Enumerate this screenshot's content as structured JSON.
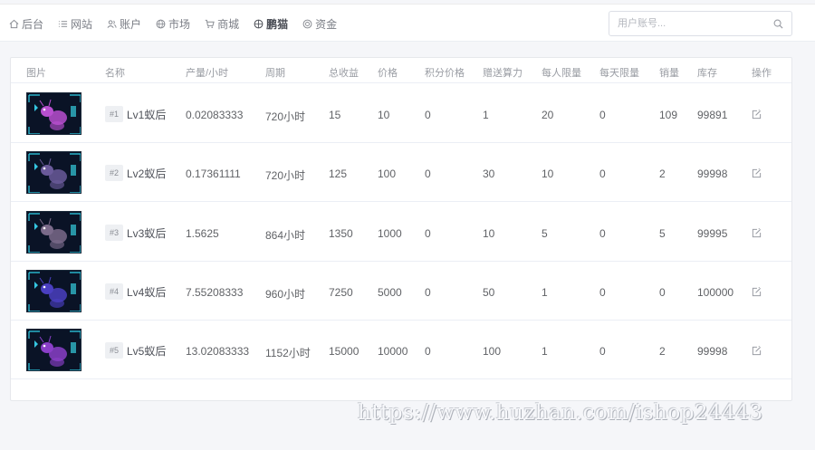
{
  "nav": {
    "items": [
      {
        "label": "后台",
        "icon": "home-icon",
        "active": false
      },
      {
        "label": "网站",
        "icon": "list-icon",
        "active": false
      },
      {
        "label": "账户",
        "icon": "users-icon",
        "active": false
      },
      {
        "label": "市场",
        "icon": "globe-icon",
        "active": false
      },
      {
        "label": "商城",
        "icon": "cart-icon",
        "active": false
      },
      {
        "label": "鹏猫",
        "icon": "grid-icon",
        "active": true
      },
      {
        "label": "资金",
        "icon": "coin-icon",
        "active": false
      }
    ]
  },
  "search": {
    "placeholder": "用户账号...",
    "icon": "search-icon"
  },
  "table": {
    "headers": [
      "图片",
      "名称",
      "产量/小时",
      "周期",
      "总收益",
      "价格",
      "积分价格",
      "赠送算力",
      "每人限量",
      "每天限量",
      "销量",
      "库存",
      "操作"
    ],
    "rows": [
      {
        "index": "#1",
        "name": "Lv1蚁后",
        "output": "0.02083333",
        "cycle": "720小时",
        "total": "15",
        "price": "10",
        "points_price": "0",
        "bonus_power": "1",
        "per_person": "20",
        "per_day": "0",
        "sales": "109",
        "stock": "99891"
      },
      {
        "index": "#2",
        "name": "Lv2蚁后",
        "output": "0.17361111",
        "cycle": "720小时",
        "total": "125",
        "price": "100",
        "points_price": "0",
        "bonus_power": "30",
        "per_person": "10",
        "per_day": "0",
        "sales": "2",
        "stock": "99998"
      },
      {
        "index": "#3",
        "name": "Lv3蚁后",
        "output": "1.5625",
        "cycle": "864小时",
        "total": "1350",
        "price": "1000",
        "points_price": "0",
        "bonus_power": "10",
        "per_person": "5",
        "per_day": "0",
        "sales": "5",
        "stock": "99995"
      },
      {
        "index": "#4",
        "name": "Lv4蚁后",
        "output": "7.55208333",
        "cycle": "960小时",
        "total": "7250",
        "price": "5000",
        "points_price": "0",
        "bonus_power": "50",
        "per_person": "1",
        "per_day": "0",
        "sales": "0",
        "stock": "100000"
      },
      {
        "index": "#5",
        "name": "Lv5蚁后",
        "output": "13.02083333",
        "cycle": "1152小时",
        "total": "15000",
        "price": "10000",
        "points_price": "0",
        "bonus_power": "100",
        "per_person": "1",
        "per_day": "0",
        "sales": "2",
        "stock": "99998"
      }
    ]
  },
  "watermark": "https://www.huzhan.com/ishop24443",
  "colors": {
    "active_nav": "#4a4d55",
    "border": "#ebeef5",
    "ant_tints": [
      "#b84fd0",
      "#6a5a9a",
      "#7a6a8a",
      "#4a3fc0",
      "#8a3fc8"
    ]
  }
}
